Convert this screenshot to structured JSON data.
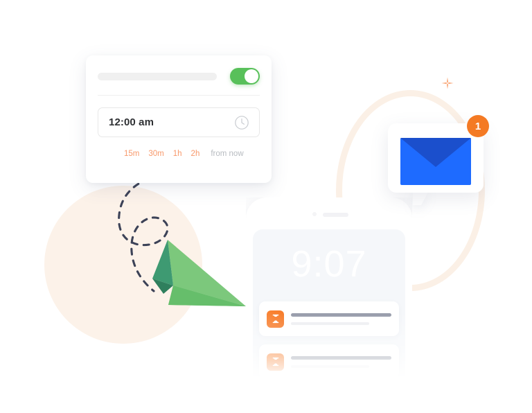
{
  "illustration": {
    "title": "Schedule send illustration"
  },
  "schedule_card": {
    "placeholder_label": "",
    "toggle": {
      "name": "schedule-toggle",
      "state": "on",
      "color": "#58C05A"
    },
    "time_input": {
      "value": "12:00 am",
      "placeholder": "12:00 am",
      "icon": "clock-icon"
    },
    "quick_options": [
      {
        "label": "15m"
      },
      {
        "label": "30m"
      },
      {
        "label": "1h"
      },
      {
        "label": "2h"
      }
    ],
    "quick_suffix": "from now",
    "accent_color": "#F8996B"
  },
  "email_bubble": {
    "icon": "envelope-icon",
    "badge_count": "1",
    "badge_color": "#F47A24",
    "envelope_color": "#1E6BFF",
    "envelope_flap_color": "#1B4FCC"
  },
  "phone": {
    "clock": "9:07",
    "camera_icon": "camera-dot-icon",
    "speaker_icon": "speaker-grille-icon",
    "notifications": [
      {
        "icon": "hourglass-icon",
        "title": "",
        "subtitle": ""
      },
      {
        "icon": "hourglass-icon",
        "title": "",
        "subtitle": ""
      }
    ]
  },
  "decor": {
    "paper_plane": {
      "icon": "paper-plane-icon",
      "light_color": "#7CC87C",
      "dark_color": "#3E9A72"
    },
    "dashed_trail": {
      "icon": "dashed-path-icon",
      "color": "#3C4257"
    },
    "peach_circle": {
      "color": "#FCF2E9"
    },
    "peach_ring": {
      "color": "#FBF0E6"
    },
    "sparkle": {
      "icon": "sparkle-icon",
      "color": "#F9A97B"
    }
  }
}
